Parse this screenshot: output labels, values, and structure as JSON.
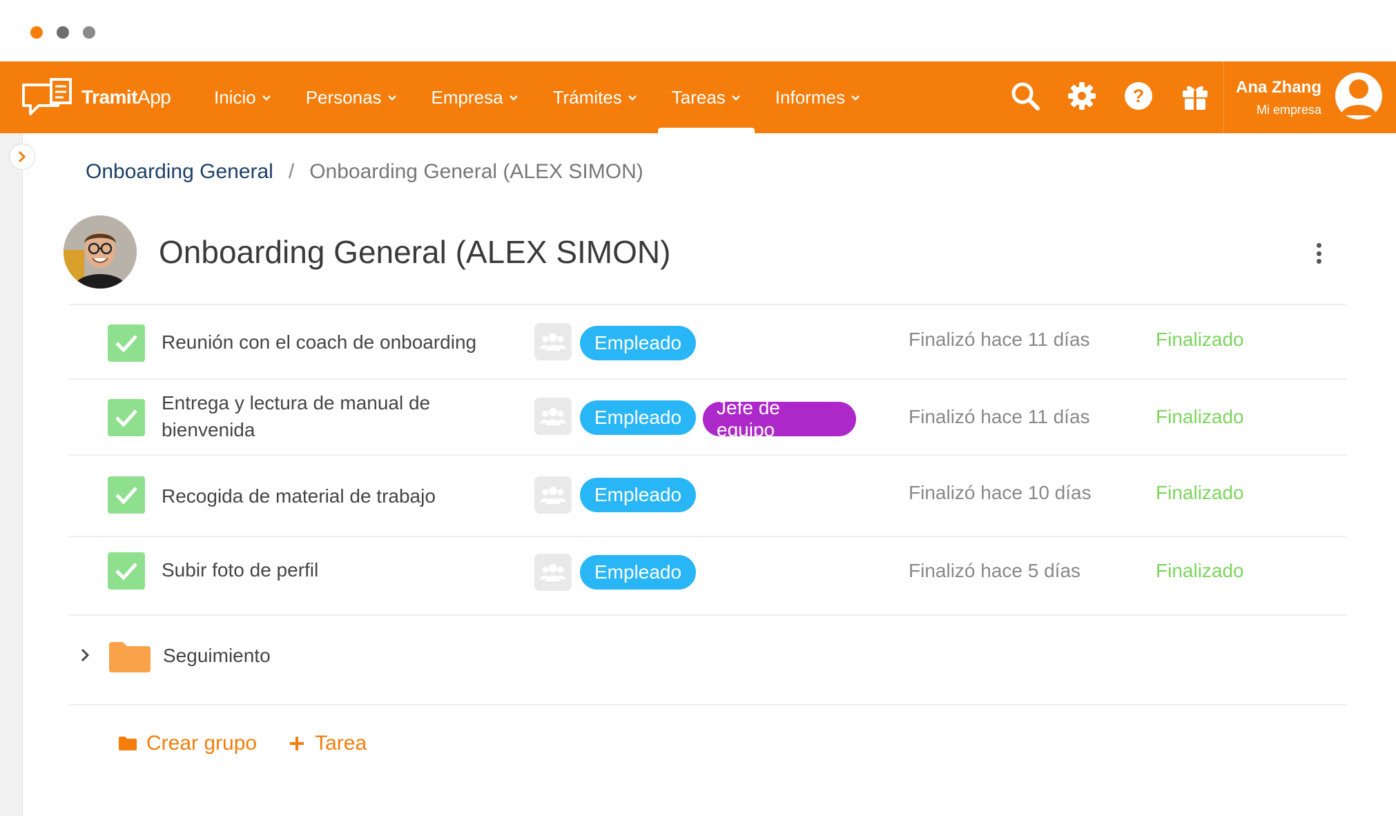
{
  "window": {
    "dot_colors": [
      "#f47d0b",
      "#6e6e6e",
      "#8a8a8a"
    ]
  },
  "brand": {
    "name_a": "Tramit",
    "name_b": "App",
    "accent": "#f47d0b"
  },
  "nav": {
    "items": [
      {
        "label": "Inicio",
        "active": false
      },
      {
        "label": "Personas",
        "active": false
      },
      {
        "label": "Empresa",
        "active": false
      },
      {
        "label": "Trámites",
        "active": false
      },
      {
        "label": "Tareas",
        "active": true
      },
      {
        "label": "Informes",
        "active": false
      }
    ],
    "chevron": "⌄",
    "icons": [
      "search-icon",
      "gear-icon",
      "help-icon",
      "gift-icon"
    ]
  },
  "user": {
    "name": "Ana Zhang",
    "company": "Mi empresa"
  },
  "breadcrumb": {
    "parent": "Onboarding General",
    "separator": "/",
    "current": "Onboarding General (ALEX SIMON)"
  },
  "page": {
    "title": "Onboarding General (ALEX SIMON)"
  },
  "tasks": [
    {
      "name": "Reunión con el coach de onboarding",
      "roles": [
        "Empleado"
      ],
      "finished": "Finalizó hace 11 días",
      "status": "Finalizado"
    },
    {
      "name": "Entrega y lectura de manual de bienvenida",
      "roles": [
        "Empleado",
        "Jefe de equipo"
      ],
      "finished": "Finalizó hace 11 días",
      "status": "Finalizado"
    },
    {
      "name": "Recogida de material de trabajo",
      "roles": [
        "Empleado"
      ],
      "finished": "Finalizó hace 10 días",
      "status": "Finalizado"
    },
    {
      "name": "Subir foto de perfil",
      "roles": [
        "Empleado"
      ],
      "finished": "Finalizó hace 5 días",
      "status": "Finalizado"
    }
  ],
  "folder": {
    "label": "Seguimiento"
  },
  "actions": {
    "create_group": "Crear grupo",
    "add_task": "Tarea"
  },
  "colors": {
    "role_empleado": "#29b6f6",
    "role_jefe": "#ad28c8",
    "status_done": "#7cd55c",
    "check": "#8ee08f"
  }
}
